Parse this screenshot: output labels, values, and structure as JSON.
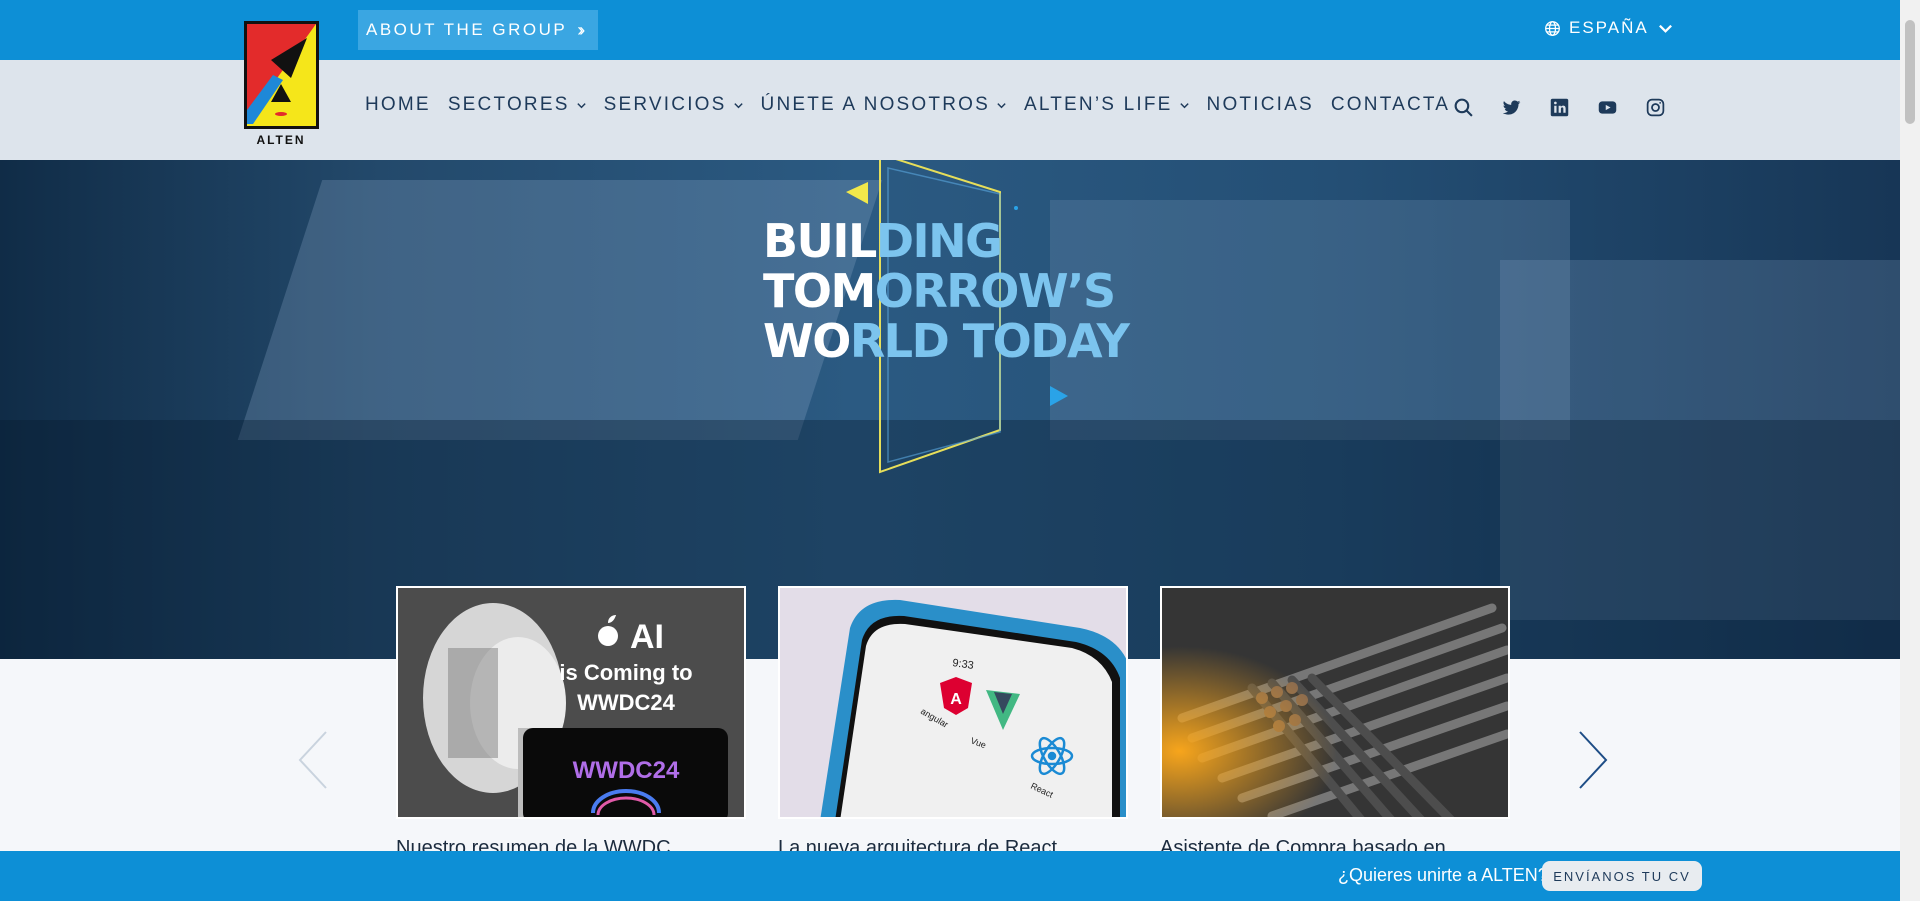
{
  "topbar": {
    "about_label": "ABOUT THE GROUP",
    "language": "ESPAÑA",
    "bg_color": "#0d8fd6"
  },
  "logo": {
    "text": "ALTEN"
  },
  "nav": {
    "items": [
      {
        "label": "HOME",
        "has_dropdown": false
      },
      {
        "label": "SECTORES",
        "has_dropdown": true
      },
      {
        "label": "SERVICIOS",
        "has_dropdown": true
      },
      {
        "label": "ÚNETE A NOSOTROS",
        "has_dropdown": true
      },
      {
        "label": "ALTEN’S LIFE",
        "has_dropdown": true
      },
      {
        "label": "NOTICIAS",
        "has_dropdown": false
      },
      {
        "label": "CONTACTA",
        "has_dropdown": false
      }
    ],
    "icons": [
      "search-icon",
      "twitter-icon",
      "linkedin-icon",
      "youtube-icon",
      "instagram-icon"
    ]
  },
  "hero": {
    "line1_white": "BUIL",
    "line1_blue": "DING",
    "line2_white": "TOM",
    "line2_blue": "ORROW’S",
    "line3_white": "WO",
    "line3_blue": "RLD TODAY",
    "accent_yellow": "#f2e84a",
    "accent_blue": "#2aa3e8"
  },
  "cards": [
    {
      "title": "Nuestro resumen de la WWDC",
      "image_text": {
        "line1": "AI",
        "line2": "is Coming to",
        "line3": "WWDC24",
        "screen": "WWDC24"
      }
    },
    {
      "title": "La nueva arquitectura de React",
      "image_text": {
        "time": "9:33",
        "a1": "angular",
        "a2": "Vue",
        "a3": "React"
      }
    },
    {
      "title": "Asistente de Compra basado en",
      "image_text": {}
    }
  ],
  "bottombar": {
    "question": "¿Quieres unirte a ALTEN?",
    "cv_button": "ENVÍANOS TU CV"
  }
}
